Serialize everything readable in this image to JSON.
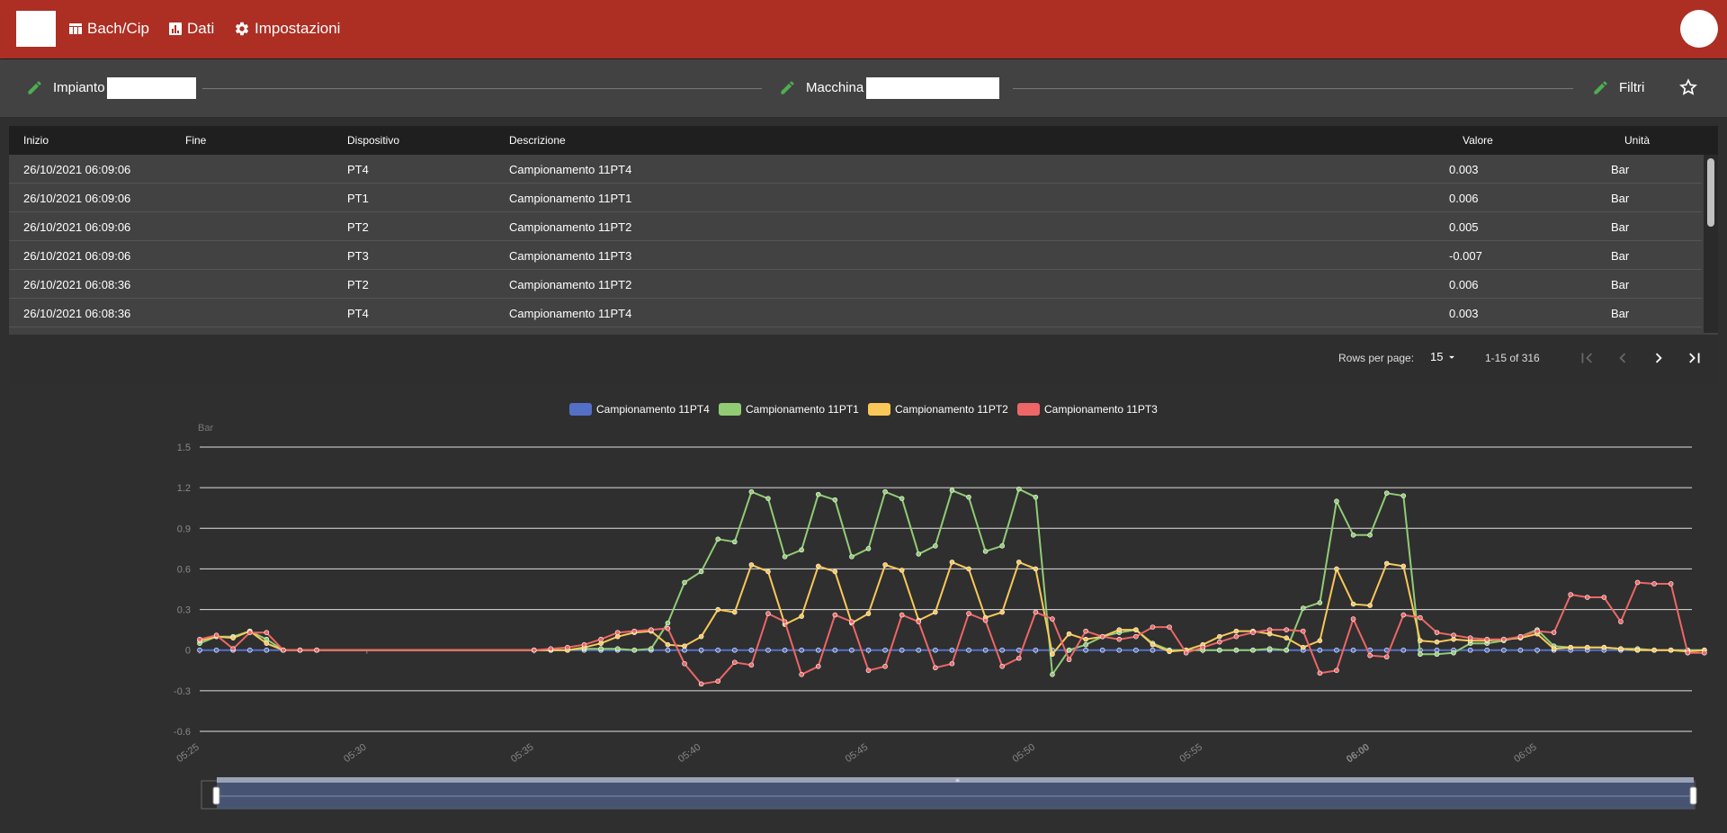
{
  "nav": {
    "items": [
      {
        "label": "Bach/Cip",
        "icon": "table-icon"
      },
      {
        "label": "Dati",
        "icon": "bar-chart-icon"
      },
      {
        "label": "Impostazioni",
        "icon": "gear-icon"
      }
    ]
  },
  "filters": {
    "impianto_label": "Impianto",
    "macchina_label": "Macchina",
    "filtri_label": "Filtri"
  },
  "table": {
    "columns": [
      "Inizio",
      "Fine",
      "Dispositivo",
      "Descrizione",
      "Valore",
      "Unità"
    ],
    "rows": [
      {
        "inizio": "26/10/2021 06:09:06",
        "fine": "",
        "dispositivo": "PT4",
        "descrizione": "Campionamento 11PT4",
        "valore": "0.003",
        "unita": "Bar"
      },
      {
        "inizio": "26/10/2021 06:09:06",
        "fine": "",
        "dispositivo": "PT1",
        "descrizione": "Campionamento 11PT1",
        "valore": "0.006",
        "unita": "Bar"
      },
      {
        "inizio": "26/10/2021 06:09:06",
        "fine": "",
        "dispositivo": "PT2",
        "descrizione": "Campionamento 11PT2",
        "valore": "0.005",
        "unita": "Bar"
      },
      {
        "inizio": "26/10/2021 06:09:06",
        "fine": "",
        "dispositivo": "PT3",
        "descrizione": "Campionamento 11PT3",
        "valore": "-0.007",
        "unita": "Bar"
      },
      {
        "inizio": "26/10/2021 06:08:36",
        "fine": "",
        "dispositivo": "PT2",
        "descrizione": "Campionamento 11PT2",
        "valore": "0.006",
        "unita": "Bar"
      },
      {
        "inizio": "26/10/2021 06:08:36",
        "fine": "",
        "dispositivo": "PT4",
        "descrizione": "Campionamento 11PT4",
        "valore": "0.003",
        "unita": "Bar"
      }
    ]
  },
  "pagination": {
    "rows_per_page_label": "Rows per page:",
    "rows_per_page_value": "15",
    "range": "1-15 of 316"
  },
  "chart_data": {
    "type": "line",
    "title": "",
    "ylabel": "Bar",
    "xlabel": "",
    "ylim": [
      -0.6,
      1.5
    ],
    "yticks": [
      "1.5",
      "1.2",
      "0.9",
      "0.6",
      "0.3",
      "0",
      "-0.3",
      "-0.6"
    ],
    "xticks": [
      "05:25",
      "05:30",
      "05:35",
      "05:40",
      "05:45",
      "05:50",
      "05:55",
      "06:00",
      "06:05"
    ],
    "x_start": "05:25",
    "x_step_minutes": 0.5,
    "grid": true,
    "legend_position": "top",
    "has_zoom_slider": true,
    "series": [
      {
        "name": "Campionamento 11PT4",
        "color": "#5470c6",
        "values": [
          0,
          0,
          0,
          0,
          0,
          0,
          0,
          0,
          null,
          null,
          null,
          null,
          null,
          null,
          null,
          null,
          null,
          null,
          null,
          null,
          0,
          0,
          0,
          0,
          0,
          0,
          0,
          0,
          0,
          0,
          0,
          0,
          0,
          0,
          0,
          0,
          0,
          0,
          0,
          0,
          0,
          0,
          0,
          0,
          0,
          0,
          0,
          0,
          0,
          0,
          0,
          0,
          0,
          0,
          0,
          0,
          0,
          0,
          0,
          0,
          0,
          0,
          0,
          0,
          0,
          0,
          0,
          0,
          0,
          0,
          0,
          0,
          0,
          0,
          0,
          0,
          0,
          0,
          0,
          0,
          0,
          0,
          0,
          0,
          0,
          0,
          0,
          0,
          0,
          0,
          0
        ]
      },
      {
        "name": "Campionamento 11PT1",
        "color": "#91cc75",
        "values": [
          0.05,
          0.1,
          0.1,
          0.14,
          0.08,
          0,
          0,
          0,
          null,
          null,
          null,
          null,
          null,
          null,
          null,
          null,
          null,
          null,
          null,
          null,
          0,
          0,
          0,
          0.01,
          0.01,
          0.01,
          0,
          0.01,
          0.2,
          0.5,
          0.58,
          0.82,
          0.8,
          1.17,
          1.12,
          0.69,
          0.74,
          1.15,
          1.11,
          0.69,
          0.75,
          1.17,
          1.12,
          0.71,
          0.77,
          1.18,
          1.13,
          0.73,
          0.77,
          1.19,
          1.13,
          -0.18,
          0,
          0.04,
          0.1,
          0.13,
          0.15,
          0.05,
          0,
          0,
          0,
          0,
          0,
          0,
          0.01,
          0,
          0.31,
          0.35,
          1.1,
          0.85,
          0.85,
          1.16,
          1.14,
          -0.03,
          -0.03,
          -0.02,
          0.05,
          0.05,
          0.07,
          0.1,
          0.15,
          0.03,
          0.02,
          0.02,
          0.02,
          0.01,
          0.01,
          0,
          0,
          0,
          0
        ]
      },
      {
        "name": "Campionamento 11PT2",
        "color": "#fac858",
        "values": [
          0.07,
          0.1,
          0.09,
          0.14,
          0.05,
          0,
          0,
          0,
          null,
          null,
          null,
          null,
          null,
          null,
          null,
          null,
          null,
          null,
          null,
          null,
          0,
          0,
          0,
          0.02,
          0.05,
          0.1,
          0.13,
          0.14,
          0.04,
          0.03,
          0.1,
          0.3,
          0.28,
          0.63,
          0.58,
          0.19,
          0.25,
          0.62,
          0.58,
          0.2,
          0.27,
          0.63,
          0.59,
          0.22,
          0.28,
          0.65,
          0.6,
          0.24,
          0.28,
          0.65,
          0.6,
          -0.03,
          0.12,
          0.08,
          0.1,
          0.15,
          0.15,
          0.04,
          -0.01,
          0,
          0.04,
          0.1,
          0.14,
          0.14,
          0.12,
          0.09,
          0.02,
          0.07,
          0.6,
          0.34,
          0.33,
          0.64,
          0.62,
          0.07,
          0.06,
          0.08,
          0.07,
          0.07,
          0.08,
          0.09,
          0.12,
          0.01,
          0.02,
          0.02,
          0.02,
          0.01,
          0,
          0,
          0,
          -0.01,
          0
        ]
      },
      {
        "name": "Campionamento 11PT3",
        "color": "#ee6666",
        "values": [
          0.08,
          0.11,
          0.01,
          0.13,
          0.13,
          0,
          0,
          0,
          null,
          null,
          null,
          null,
          null,
          null,
          null,
          null,
          null,
          null,
          null,
          null,
          0,
          0.01,
          0.02,
          0.04,
          0.08,
          0.13,
          0.14,
          0.15,
          0.16,
          -0.1,
          -0.25,
          -0.23,
          -0.09,
          -0.11,
          0.27,
          0.21,
          -0.18,
          -0.12,
          0.26,
          0.21,
          -0.15,
          -0.12,
          0.26,
          0.21,
          -0.13,
          -0.1,
          0.27,
          0.22,
          -0.12,
          -0.06,
          0.28,
          0.23,
          -0.07,
          0.14,
          0.1,
          0.08,
          0.1,
          0.17,
          0.17,
          -0.02,
          0.02,
          0.06,
          0.1,
          0.13,
          0.15,
          0.15,
          0.14,
          -0.17,
          -0.15,
          0.23,
          -0.04,
          -0.05,
          0.26,
          0.24,
          0.13,
          0.11,
          0.09,
          0.08,
          0.08,
          0.1,
          0.14,
          0.13,
          0.41,
          0.39,
          0.39,
          0.21,
          0.5,
          0.49,
          0.49,
          -0.02,
          -0.02
        ]
      }
    ]
  }
}
